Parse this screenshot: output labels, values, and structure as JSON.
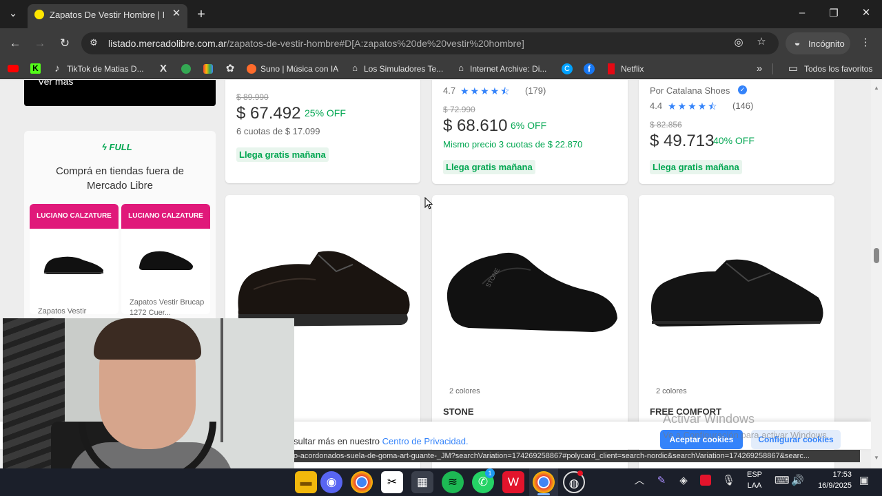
{
  "browser": {
    "tab_title": "Zapatos De Vestir Hombre | Me",
    "url_domain": "listado.mercadolibre.com.ar",
    "url_path": "/zapatos-de-vestir-hombre#D[A:zapatos%20de%20vestir%20hombre]",
    "profile_label": "Incógnito",
    "bookmarks": [
      "TikTok de Matias D...",
      "Suno | Música con IA",
      "Los Simuladores Te...",
      "Internet Archive: Di...",
      "Netflix"
    ],
    "all_bookmarks": "Todos los favoritos"
  },
  "sidebar": {
    "view_more": "Ver más",
    "full_badge": "FULL",
    "stores_title_1": "Comprá en tiendas fuera de",
    "stores_title_2": "Mercado Libre",
    "store_items": [
      {
        "badge": "LUCIANO CALZATURE",
        "title": "Zapatos Vestir"
      },
      {
        "badge": "LUCIANO CALZATURE",
        "title": "Zapatos Vestir Brucap 1272 Cuer..."
      }
    ]
  },
  "top_row": [
    {
      "original_price": "$ 89.990",
      "price": "$ 67.492",
      "discount": "25% OFF",
      "installments": "6 cuotas de $ 17.099",
      "shipping": "Llega gratis mañana"
    },
    {
      "rating": "4.7",
      "reviews": "(179)",
      "original_price": "$ 72.990",
      "price": "$ 68.610",
      "discount": "6% OFF",
      "installments": "Mismo precio 3 cuotas de $ 22.870",
      "shipping": "Llega gratis mañana"
    },
    {
      "seller": "Por Catalana Shoes",
      "rating": "4.4",
      "reviews": "(146)",
      "original_price": "$ 82.856",
      "price": "$ 49.713",
      "discount": "40% OFF",
      "shipping": "Llega gratis mañana"
    }
  ],
  "bottom_row": [
    {
      "colors": "",
      "brand": ""
    },
    {
      "colors": "2 colores",
      "brand": "STONE"
    },
    {
      "colors": "2 colores",
      "brand": "FREE COMFORT"
    }
  ],
  "cookie_bar": {
    "text": "sultar más en nuestro",
    "link": "Centro de Privacidad.",
    "accept": "Aceptar cookies",
    "configure": "Configurar cookies"
  },
  "watermark": {
    "line1": "Activar Windows",
    "line2": "Ve a Configuración para activar Windows."
  },
  "status_url": "o-acordonados-suela-de-goma-art-guante-_JM?searchVariation=174269258867#polycard_client=search-nordic&searchVariation=174269258867&searc...",
  "taskbar": {
    "lang_1": "ESP",
    "lang_2": "LAA",
    "time": "17:53",
    "date": "16/9/2025",
    "whatsapp_count": "1"
  },
  "colors": {
    "brand_green": "#00a650",
    "brand_blue": "#3483fa",
    "store_pink": "#e0197a"
  }
}
